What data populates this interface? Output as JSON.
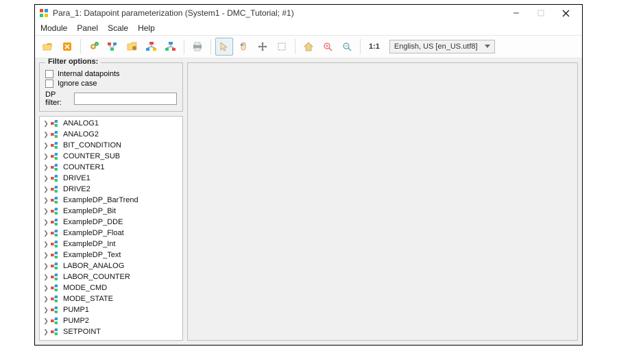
{
  "window": {
    "title": "Para_1: Datapoint parameterization (System1 - DMC_Tutorial; #1)"
  },
  "menu": {
    "module": "Module",
    "panel": "Panel",
    "scale": "Scale",
    "help": "Help"
  },
  "toolbar": {
    "one_to_one": "1:1",
    "language_selected": "English, US [en_US.utf8]"
  },
  "filter": {
    "legend": "Filter options:",
    "internal_label": "Internal datapoints",
    "ignorecase_label": "Ignore case",
    "dpfilter_label": "DP filter:",
    "dpfilter_value": ""
  },
  "tree": {
    "items": [
      {
        "label": "ANALOG1"
      },
      {
        "label": "ANALOG2"
      },
      {
        "label": "BIT_CONDITION"
      },
      {
        "label": "COUNTER_SUB"
      },
      {
        "label": "COUNTER1"
      },
      {
        "label": "DRIVE1"
      },
      {
        "label": "DRIVE2"
      },
      {
        "label": "ExampleDP_BarTrend"
      },
      {
        "label": "ExampleDP_Bit"
      },
      {
        "label": "ExampleDP_DDE"
      },
      {
        "label": "ExampleDP_Float"
      },
      {
        "label": "ExampleDP_Int"
      },
      {
        "label": "ExampleDP_Text"
      },
      {
        "label": "LABOR_ANALOG"
      },
      {
        "label": "LABOR_COUNTER"
      },
      {
        "label": "MODE_CMD"
      },
      {
        "label": "MODE_STATE"
      },
      {
        "label": "PUMP1"
      },
      {
        "label": "PUMP2"
      },
      {
        "label": "SETPOINT"
      }
    ]
  }
}
